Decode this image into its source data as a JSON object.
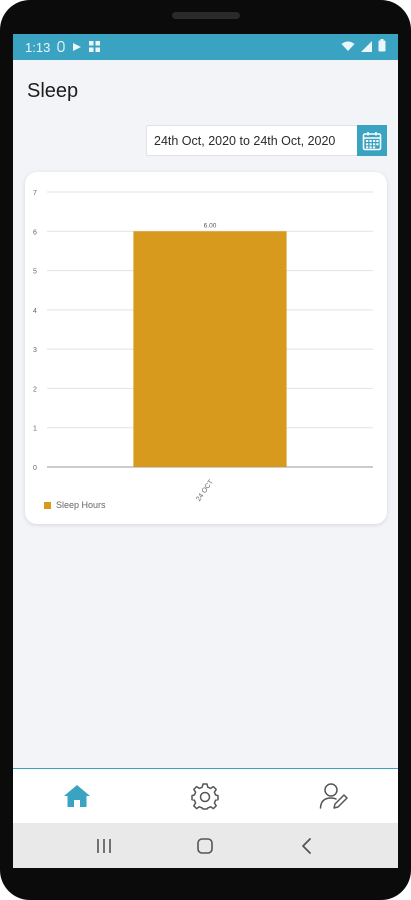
{
  "status_bar": {
    "time": "1:13",
    "icons_left": [
      "notification-icon",
      "play-icon",
      "grid-icon"
    ],
    "icons_right": [
      "wifi-icon",
      "signal-icon",
      "battery-icon"
    ]
  },
  "page": {
    "title": "Sleep"
  },
  "date_range": {
    "label": "24th Oct, 2020 to 24th Oct, 2020",
    "icon": "calendar-icon"
  },
  "colors": {
    "accent": "#3aa3c2",
    "bar": "#d79a1c",
    "background": "#f2f4f7"
  },
  "chart_data": {
    "type": "bar",
    "categories": [
      "24 OCT"
    ],
    "series": [
      {
        "name": "Sleep Hours",
        "values": [
          6.0
        ],
        "data_labels": [
          "6.00"
        ]
      }
    ],
    "yticks": [
      "0",
      "1",
      "2",
      "3",
      "4",
      "5",
      "6",
      "7"
    ],
    "ylim": [
      0,
      7
    ],
    "grid": true,
    "legend": "bottom-left"
  },
  "bottom_nav": {
    "items": [
      {
        "icon": "home-icon",
        "active": true
      },
      {
        "icon": "gear-icon",
        "active": false
      },
      {
        "icon": "user-edit-icon",
        "active": false
      }
    ]
  },
  "system_nav": {
    "items": [
      "recents-icon",
      "home-circle-icon",
      "back-icon"
    ]
  }
}
